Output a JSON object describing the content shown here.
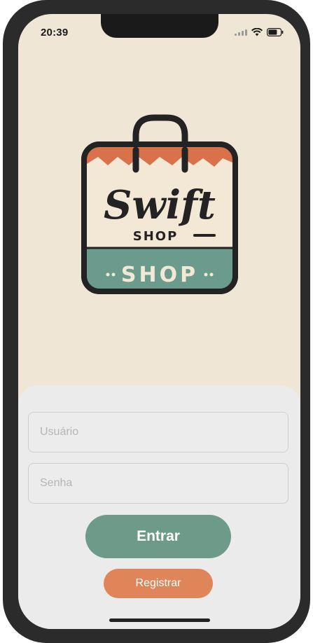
{
  "status_bar": {
    "time": "20:39",
    "icons": [
      "signal-icon",
      "wifi-icon",
      "battery-icon"
    ]
  },
  "logo": {
    "script_text": "Swift",
    "small_text": "SHOP",
    "band_text": "SHOP",
    "colors": {
      "outline": "#232323",
      "bag_body": "#f2e8d5",
      "bag_top": "#d9724a",
      "bag_band": "#6a9b8c"
    }
  },
  "login": {
    "username": {
      "placeholder": "Usuário",
      "value": ""
    },
    "password": {
      "placeholder": "Senha",
      "value": ""
    },
    "enter_label": "Entrar",
    "register_label": "Registrar"
  },
  "colors": {
    "background": "#efe6d6",
    "card": "#ebebeb",
    "primary_button": "#6e9a8a",
    "secondary_button": "#e0855a"
  }
}
